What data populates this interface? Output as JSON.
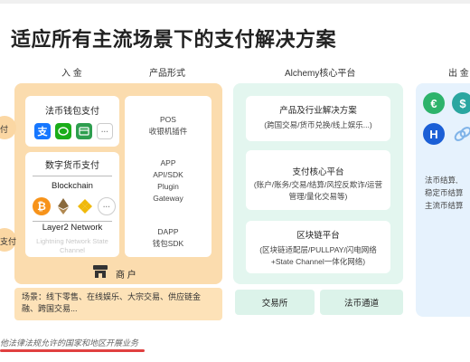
{
  "title": "适应所有主流场景下的支付解决方案",
  "columns": {
    "inbound": "入 金",
    "product_form": "产品形式",
    "alchemy": "Alchemy核心平台",
    "outbound": "出 金"
  },
  "side": {
    "label_top": "付",
    "label_bottom": "支付"
  },
  "fiat_wallet": {
    "title": "法币钱包支付",
    "icons": [
      "alipay-icon",
      "wechat-pay-icon",
      "unionpay-icon",
      "more-icon"
    ],
    "more_glyph": "···"
  },
  "crypto_pay": {
    "title": "数字货币支付",
    "blockchain_label": "Blockchain",
    "layer2_label": "Layer2 Network",
    "layer2_desc": "Lightning Network State Channel",
    "more_glyph": "···"
  },
  "product_forms": {
    "pos": [
      "POS",
      "收银机插件"
    ],
    "app": [
      "APP",
      "API/SDK",
      "Plugin",
      "Gateway"
    ],
    "dapp": [
      "DAPP",
      "钱包SDK"
    ]
  },
  "merchant": {
    "label": "商 户"
  },
  "scenes": "场景：线下零售、在线娱乐、大宗交易、供应链金融、跨国交易...",
  "alchemy": {
    "solutions": {
      "title": "产品及行业解决方案",
      "desc": "(跨国交易/货币兑换/线上娱乐...)"
    },
    "payment_core": {
      "title": "支付核心平台",
      "desc": "(账户/账务/交易/结算/风控反欺诈/运营管理/量化交易等)"
    },
    "blockchain_platform": {
      "title": "区块链平台",
      "desc": "(区块链适配层/PULLPAY/闪电网络+State Channel一体化网络)"
    },
    "exchange": "交易所",
    "fiat_channel": "法币通道"
  },
  "outbound": {
    "lines": [
      "法币结算,",
      "稳定币结算",
      "主流币结算"
    ]
  },
  "footer": "他法律法规允许的国家和地区开展业务",
  "colors": {
    "orange_panel": "#fbdcae",
    "green_panel": "#e3f6ef",
    "blue_panel": "#e6f2fd",
    "underline": "#e04040"
  }
}
